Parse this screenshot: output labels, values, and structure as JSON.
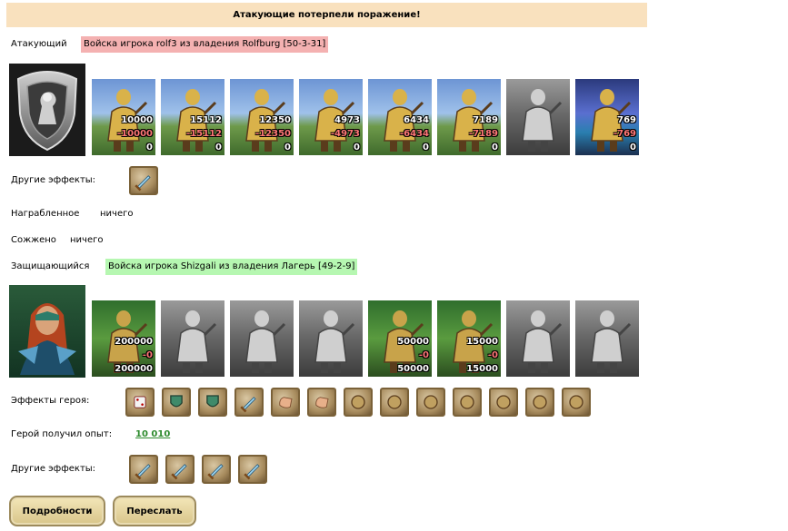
{
  "result_banner": "Атакующие потерпели поражение!",
  "attacker": {
    "label": "Атакующий",
    "troops_tag": "Войска игрока rolf3 из владения Rolfburg [50-3-31]",
    "units": [
      {
        "name": "peasant-cart-icon",
        "count": "10000",
        "loss": "-10000",
        "left": "0",
        "theme": "sky"
      },
      {
        "name": "griffin-knight-icon",
        "count": "15112",
        "loss": "-15112",
        "left": "0",
        "theme": "sky"
      },
      {
        "name": "cavalier-icon",
        "count": "12350",
        "loss": "-12350",
        "left": "0",
        "theme": "sky"
      },
      {
        "name": "griffin-icon",
        "count": "4973",
        "loss": "-4973",
        "left": "0",
        "theme": "sky"
      },
      {
        "name": "crossbowman-icon",
        "count": "6434",
        "loss": "-6434",
        "left": "0",
        "theme": "sky"
      },
      {
        "name": "monk-icon",
        "count": "7189",
        "loss": "-7189",
        "left": "0",
        "theme": "sky"
      },
      {
        "name": "swordsman-icon",
        "count": "",
        "loss": "",
        "left": "",
        "theme": "grey"
      },
      {
        "name": "archangel-icon",
        "count": "769",
        "loss": "-769",
        "left": "0",
        "theme": "night"
      }
    ],
    "other_effects_label": "Другие эффекты:",
    "other_effects": [
      "sword-fist-effect-icon"
    ]
  },
  "looted": {
    "label": "Награбленное",
    "value": "ничего"
  },
  "burned": {
    "label": "Сожжено",
    "value": "ничего"
  },
  "defender": {
    "label": "Защищающийся",
    "troops_tag": "Войска игрока Shizgali из владения Лагерь [49-2-9]",
    "units": [
      {
        "name": "dwarf-icon",
        "count": "200000",
        "loss": "-0",
        "left": "200000",
        "theme": "forest"
      },
      {
        "name": "armored-knight-icon",
        "count": "",
        "loss": "",
        "left": "",
        "theme": "grey"
      },
      {
        "name": "spearman-icon",
        "count": "",
        "loss": "",
        "left": "",
        "theme": "grey"
      },
      {
        "name": "griffin-grey-icon",
        "count": "",
        "loss": "",
        "left": "",
        "theme": "grey"
      },
      {
        "name": "elf-archer-icon",
        "count": "50000",
        "loss": "-0",
        "left": "50000",
        "theme": "forest"
      },
      {
        "name": "druid-icon",
        "count": "15000",
        "loss": "-0",
        "left": "15000",
        "theme": "forest"
      },
      {
        "name": "hooded-monk-icon",
        "count": "",
        "loss": "",
        "left": "",
        "theme": "grey"
      },
      {
        "name": "sorcerer-icon",
        "count": "",
        "loss": "",
        "left": "",
        "theme": "grey"
      }
    ],
    "hero_effects_label": "Эффекты героя:",
    "hero_effects": [
      "dice-effect-icon",
      "shield-effect-icon",
      "handshake-shield-effect-icon",
      "sword-effect-icon",
      "handshake-effect-icon",
      "hand-effect-icon",
      "helmet-effect-icon",
      "amulet-effect-icon",
      "armor-effect-icon",
      "crossed-arrows-effect-icon",
      "book-effect-icon",
      "trident-effect-icon",
      "medallion-effect-icon"
    ],
    "experience_label": "Герой получил опыт:",
    "experience_value": "10 010",
    "other_effects_label": "Другие эффекты:",
    "other_effects": [
      "sword-fist-effect-icon",
      "sword-blue-effect-icon",
      "sword-blue-effect-icon",
      "sword-fist-effect-icon"
    ]
  },
  "buttons": {
    "details": "Подробности",
    "forward": "Переслать"
  },
  "colors": {
    "banner": "#f9e1be",
    "attacker_tag": "#f4b1b1",
    "defender_tag": "#b6f7b1",
    "exp": "#2e8b2e"
  }
}
